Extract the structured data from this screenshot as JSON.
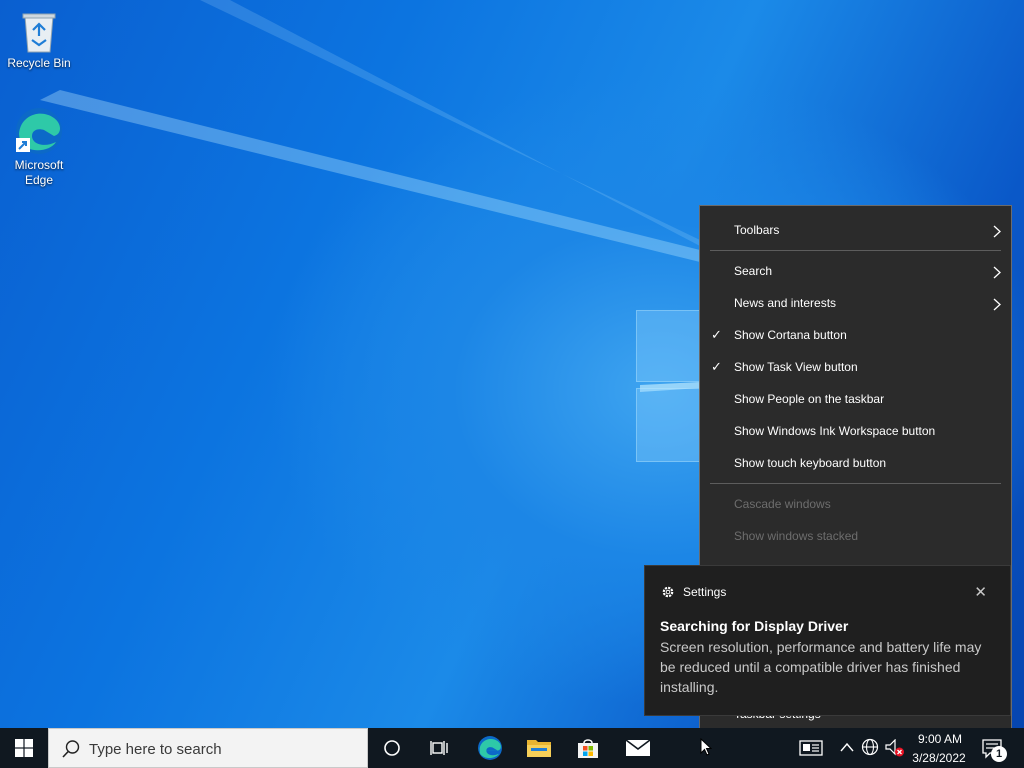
{
  "desktop": {
    "icons": [
      {
        "label": "Recycle Bin",
        "icon": "recycle-bin-icon"
      },
      {
        "label": "Microsoft\nEdge",
        "icon": "edge-icon"
      }
    ]
  },
  "context_menu": {
    "items": [
      {
        "label": "Toolbars",
        "submenu": true
      },
      {
        "label": "Search",
        "submenu": true
      },
      {
        "label": "News and interests",
        "submenu": true
      },
      {
        "label": "Show Cortana button",
        "checked": true
      },
      {
        "label": "Show Task View button",
        "checked": true
      },
      {
        "label": "Show People on the taskbar"
      },
      {
        "label": "Show Windows Ink Workspace button"
      },
      {
        "label": "Show touch keyboard button"
      },
      {
        "label": "Cascade windows",
        "disabled": true
      },
      {
        "label": "Show windows stacked",
        "disabled": true
      },
      {
        "label": "Taskbar settings"
      }
    ],
    "checkmark": "✓"
  },
  "toast": {
    "app_name": "Settings",
    "title": "Searching for Display Driver",
    "body": "Screen resolution, performance and battery life may be reduced until a compatible driver has finished installing.",
    "close_glyph": "✕"
  },
  "taskbar": {
    "search_placeholder": "Type here to search",
    "pinned": [
      "cortana-icon",
      "task-view-icon",
      "edge-icon",
      "file-explorer-icon",
      "store-icon",
      "mail-icon"
    ],
    "clock": {
      "time": "9:00 AM",
      "date": "3/28/2022"
    },
    "notification_count": "1"
  },
  "colors": {
    "accent": "#0078d7",
    "menu_bg": "#2b2b2b",
    "toast_bg": "#1f1f1f",
    "taskbar_bg": "#101820"
  }
}
